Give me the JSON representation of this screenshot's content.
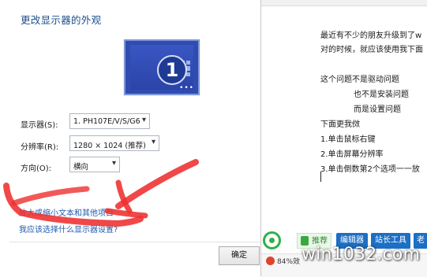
{
  "settings": {
    "title": "更改显示器的外观",
    "monitor_number": "1",
    "monitor_dots": "•••",
    "display_label": "显示器(S):",
    "display_value": "1. PH107E/V/S/G6",
    "resolution_label": "分辨率(R):",
    "resolution_value": "1280 × 1024 (推荐)",
    "orientation_label": "方向(O):",
    "orientation_value": "横向",
    "link_enlarge_text": "放大或缩小文本和其他项目",
    "link_which_settings": "我应该选择什么显示器设置?",
    "ok_label": "确定"
  },
  "editor": {
    "lines": [
      "最近有不少的朋友升级到了w",
      "对的时候，就应该使用我下面",
      "",
      "这个问题不是驱动问题",
      "也不是安装问题",
      "而是设置问题",
      "下面更我傚",
      "1.单击鼠标右键",
      "2.单击屏幕分辨率",
      "3.单击倒数第2个选项一一放"
    ]
  },
  "taskbar": {
    "recommend_label": "推荐",
    "tab_editor": "编辑器",
    "tab_webmaster": "站长工具",
    "tab_more": "老",
    "percent_text": "84%效"
  },
  "watermark": "win1032.com",
  "colors": {
    "annotation_red": "#ee2f2f",
    "link_blue": "#1f5bb0",
    "tab_blue": "#1c6fc5",
    "accent_green": "#2eb14a"
  },
  "icons": {
    "status_circle": "circle-icon",
    "recommend": "leaf-icon",
    "select_caret": "chevron-down-icon",
    "status": "tomato-icon"
  }
}
